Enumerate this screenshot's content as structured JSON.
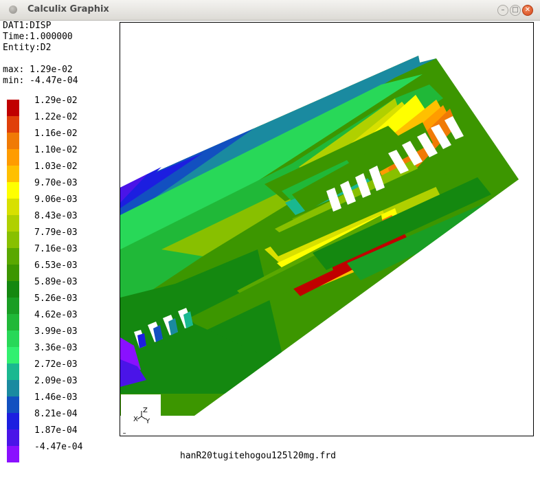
{
  "window": {
    "title": "Calculix Graphix",
    "controls": {
      "minimize": "–",
      "maximize": "□",
      "close": "✕"
    }
  },
  "info": {
    "dataset": "DAT1:DISP",
    "time": "Time:1.000000",
    "entity": "Entity:D2",
    "max": "max: 1.29e-02",
    "min": "min: -4.47e-04"
  },
  "legend": {
    "labels": [
      "1.29e-02",
      "1.22e-02",
      "1.16e-02",
      "1.10e-02",
      "1.03e-02",
      "9.70e-03",
      "9.06e-03",
      "8.43e-03",
      "7.79e-03",
      "7.16e-03",
      "6.53e-03",
      "5.89e-03",
      "5.26e-03",
      "4.62e-03",
      "3.99e-03",
      "3.36e-03",
      "2.72e-03",
      "2.09e-03",
      "1.46e-03",
      "8.21e-04",
      "1.87e-04",
      "-4.47e-04"
    ],
    "colors": [
      "#c00000",
      "#e0400a",
      "#f07a06",
      "#ff9c00",
      "#ffc000",
      "#ffff00",
      "#d8e000",
      "#b0d000",
      "#88c000",
      "#5aa800",
      "#3c9600",
      "#148810",
      "#199e24",
      "#20b838",
      "#28d858",
      "#32f070",
      "#1ab890",
      "#1a8aa0",
      "#1250c0",
      "#1c1ee0",
      "#4a14e8",
      "#8a10ff"
    ]
  },
  "viewport": {
    "triad": {
      "z": "Z",
      "x": "X",
      "y": "Y"
    },
    "corner_label": "s"
  },
  "footer": {
    "filename": "hanR20tugitehogou125l20mg.frd"
  }
}
